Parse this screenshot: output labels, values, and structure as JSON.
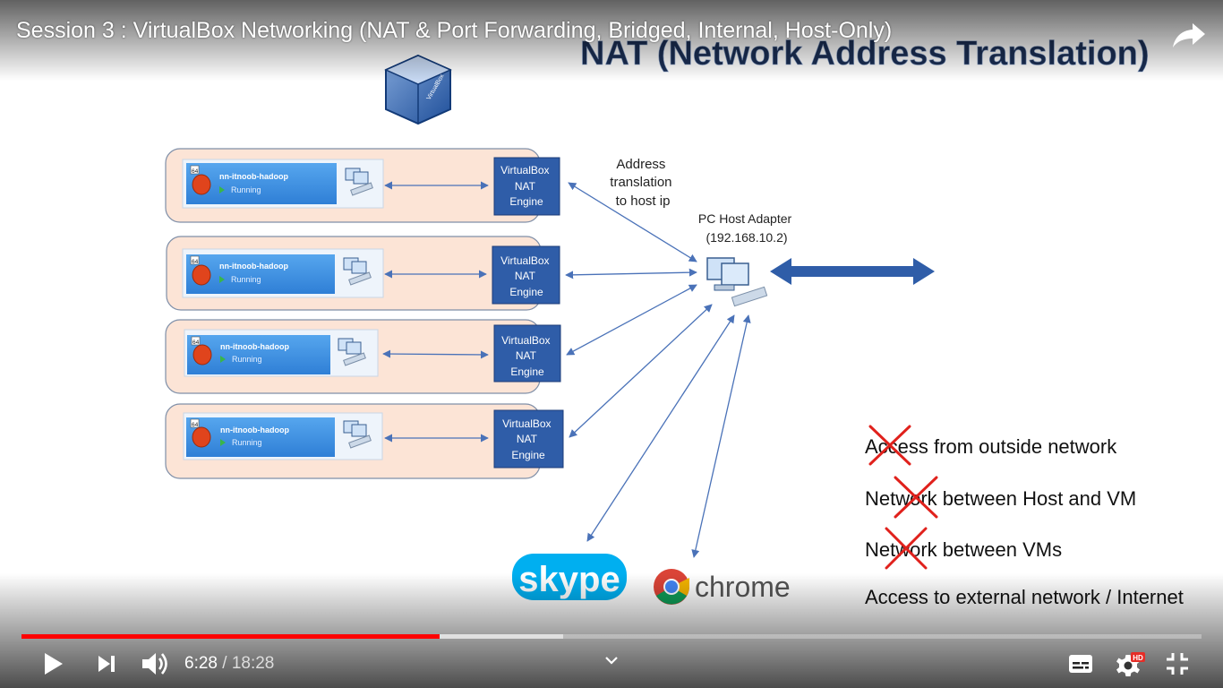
{
  "player": {
    "video_title": "Session 3 : VirtualBox Networking (NAT & Port Forwarding, Bridged, Internal, Host-Only)",
    "time_current": "6:28",
    "time_separator": " / ",
    "time_total": "18:28",
    "progress_played_fraction": 0.3543,
    "progress_buffered_fraction": 0.459,
    "accent_color": "#ff0000",
    "hd_badge": "HD",
    "icons": {
      "share": "share-icon",
      "play": "play-icon",
      "next": "next-icon",
      "volume": "volume-icon",
      "chapters": "chevron-down-icon",
      "subtitles": "subtitles-icon",
      "settings": "gear-icon",
      "fullscreen": "exit-fullscreen-icon"
    }
  },
  "slide": {
    "title": "NAT (Network Address Translation)",
    "vm_rows": [
      {
        "name": "nn-itnoob-hadoop",
        "status": "Running",
        "engine": [
          "VirtualBox",
          "NAT",
          "Engine"
        ]
      },
      {
        "name": "nn-itnoob-hadoop",
        "status": "Running",
        "engine": [
          "VirtualBox",
          "NAT",
          "Engine"
        ]
      },
      {
        "name": "nn-itnoob-hadoop",
        "status": "Running",
        "engine": [
          "VirtualBox",
          "NAT",
          "Engine"
        ]
      },
      {
        "name": "nn-itnoob-hadoop",
        "status": "Running",
        "engine": [
          "VirtualBox",
          "NAT",
          "Engine"
        ]
      }
    ],
    "address_translation": [
      "Address",
      "translation",
      "to host ip"
    ],
    "host_adapter": [
      "PC Host Adapter",
      "(192.168.10.2)"
    ],
    "vm_badge": "64",
    "vbox_logo_text": "VirtualBox",
    "skype_label": "skype",
    "chrome_label": "chrome",
    "bullets": [
      {
        "text": "Access from outside network",
        "crossed": true
      },
      {
        "text": "Network between Host and VM",
        "crossed": true
      },
      {
        "text": "Network between VMs",
        "crossed": true
      },
      {
        "text": "Access to external network / Internet",
        "crossed": false
      }
    ],
    "colors": {
      "row_fill": "#fce4d6",
      "engine_fill": "#2f5da8",
      "vm_blue": "#3d8fe0",
      "arrow": "#4a72b8",
      "cross": "#e0211c"
    }
  }
}
